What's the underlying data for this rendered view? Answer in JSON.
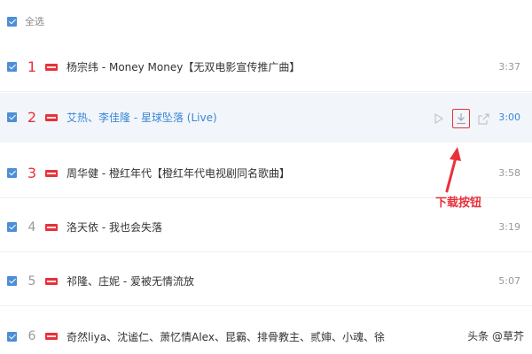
{
  "header": {
    "select_all_label": "全选"
  },
  "songs": [
    {
      "rank": "1",
      "title": "杨宗纬 - Money Money【无双电影宣传推广曲】",
      "duration": "3:37"
    },
    {
      "rank": "2",
      "title": "艾热、李佳隆 - 星球坠落 (Live)",
      "duration": "3:00"
    },
    {
      "rank": "3",
      "title": "周华健 - 橙红年代【橙红年代电视剧同名歌曲】",
      "duration": "3:58"
    },
    {
      "rank": "4",
      "title": "洛天依 - 我也会失落",
      "duration": "3:19"
    },
    {
      "rank": "5",
      "title": "祁隆、庄妮 - 爱被无情流放",
      "duration": "5:07"
    },
    {
      "rank": "6",
      "title": "奇然liya、沈谧仁、萧忆情Alex、昆霸、排骨教主、贰婶、小魂、徐...",
      "duration": ""
    }
  ],
  "annotation": {
    "label": "下载按钮"
  },
  "watermark": {
    "text": "头条 @草芥"
  },
  "icons": {
    "play": "play-icon",
    "download": "download-icon",
    "share": "share-icon",
    "new_badge": "new-badge-icon"
  },
  "colors": {
    "accent_red": "#e8313b",
    "accent_blue": "#3a86d6",
    "checkbox_blue": "#4d8fd6",
    "active_row_bg": "#f2f6fb"
  }
}
